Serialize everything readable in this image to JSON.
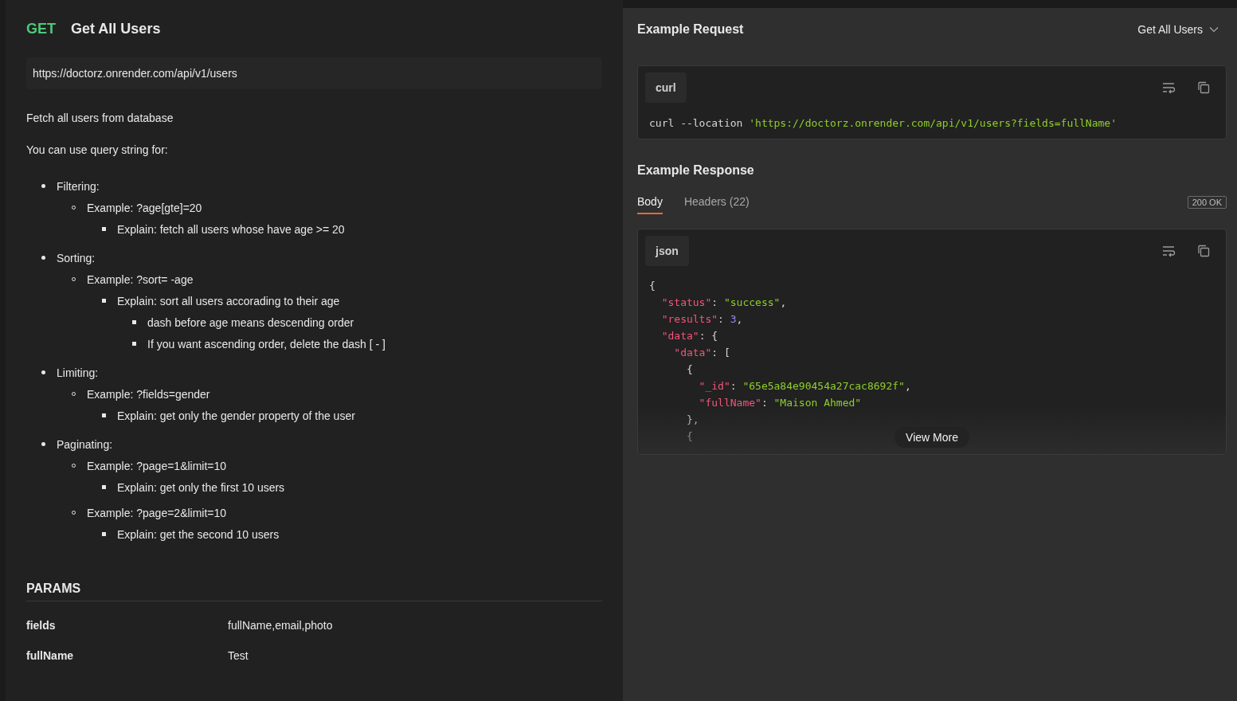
{
  "request": {
    "method": "GET",
    "name": "Get All Users",
    "url": "https://doctorz.onrender.com/api/v1/users"
  },
  "description": {
    "paragraphs": [
      "Fetch all users from database",
      "You can use query string for:"
    ],
    "bullets": [
      {
        "text": "Filtering:",
        "children": [
          {
            "text": "Example: ?age[gte]=20",
            "children": [
              {
                "text": "Explain: fetch all users whose have age >= 20"
              }
            ]
          }
        ]
      },
      {
        "text": "Sorting:",
        "children": [
          {
            "text": "Example: ?sort= -age",
            "children": [
              {
                "text": "Explain: sort all users accorading to their age",
                "children": [
                  {
                    "text": "dash before age means descending order"
                  },
                  {
                    "text": "If you want ascending order, delete the dash [ - ]"
                  }
                ]
              }
            ]
          }
        ]
      },
      {
        "text": "Limiting:",
        "children": [
          {
            "text": "Example: ?fields=gender",
            "children": [
              {
                "text": "Explain: get only the gender property of the user"
              }
            ]
          }
        ]
      },
      {
        "text": "Paginating:",
        "children": [
          {
            "text": "Example: ?page=1&limit=10",
            "children": [
              {
                "text": "Explain: get only the first 10 users"
              }
            ]
          },
          {
            "text": "Example: ?page=2&limit=10",
            "children": [
              {
                "text": "Explain: get the second 10 users"
              }
            ]
          }
        ]
      }
    ]
  },
  "params": {
    "title": "PARAMS",
    "rows": [
      {
        "name": "fields",
        "value": "fullName,email,photo"
      },
      {
        "name": "fullName",
        "value": "Test"
      }
    ]
  },
  "example_request": {
    "title": "Example Request",
    "selector": "Get All Users",
    "language": "curl",
    "code": [
      {
        "kind": "plain",
        "text": "curl --location "
      },
      {
        "kind": "string",
        "text": "'https://doctorz.onrender.com/api/v1/users?fields=fullName'"
      }
    ]
  },
  "example_response": {
    "title": "Example Response",
    "tabs": [
      {
        "label": "Body",
        "selected": true
      },
      {
        "label": "Headers (22)",
        "selected": false
      }
    ],
    "status": "200 OK",
    "language": "json",
    "view_more": "View More",
    "lines": [
      {
        "tokens": [
          {
            "kind": "punct",
            "text": "{"
          }
        ]
      },
      {
        "tokens": [
          {
            "kind": "key",
            "text": "  \"status\""
          },
          {
            "kind": "punct",
            "text": ": "
          },
          {
            "kind": "string",
            "text": "\"success\""
          },
          {
            "kind": "punct",
            "text": ","
          }
        ]
      },
      {
        "tokens": [
          {
            "kind": "key",
            "text": "  \"results\""
          },
          {
            "kind": "punct",
            "text": ": "
          },
          {
            "kind": "number",
            "text": "3"
          },
          {
            "kind": "punct",
            "text": ","
          }
        ]
      },
      {
        "tokens": [
          {
            "kind": "key",
            "text": "  \"data\""
          },
          {
            "kind": "punct",
            "text": ": {"
          }
        ]
      },
      {
        "tokens": [
          {
            "kind": "key",
            "text": "    \"data\""
          },
          {
            "kind": "punct",
            "text": ": ["
          }
        ]
      },
      {
        "tokens": [
          {
            "kind": "punct",
            "text": "      {"
          }
        ]
      },
      {
        "tokens": [
          {
            "kind": "key",
            "text": "        \"_id\""
          },
          {
            "kind": "punct",
            "text": ": "
          },
          {
            "kind": "string",
            "text": "\"65e5a84e90454a27cac8692f\""
          },
          {
            "kind": "punct",
            "text": ","
          }
        ]
      },
      {
        "tokens": [
          {
            "kind": "key",
            "text": "        \"fullName\""
          },
          {
            "kind": "punct",
            "text": ": "
          },
          {
            "kind": "string",
            "text": "\"Maison Ahmed\""
          }
        ]
      },
      {
        "tokens": [
          {
            "kind": "punct",
            "text": "      },"
          }
        ]
      },
      {
        "tokens": [
          {
            "kind": "punct",
            "text": "      {"
          }
        ]
      }
    ]
  }
}
